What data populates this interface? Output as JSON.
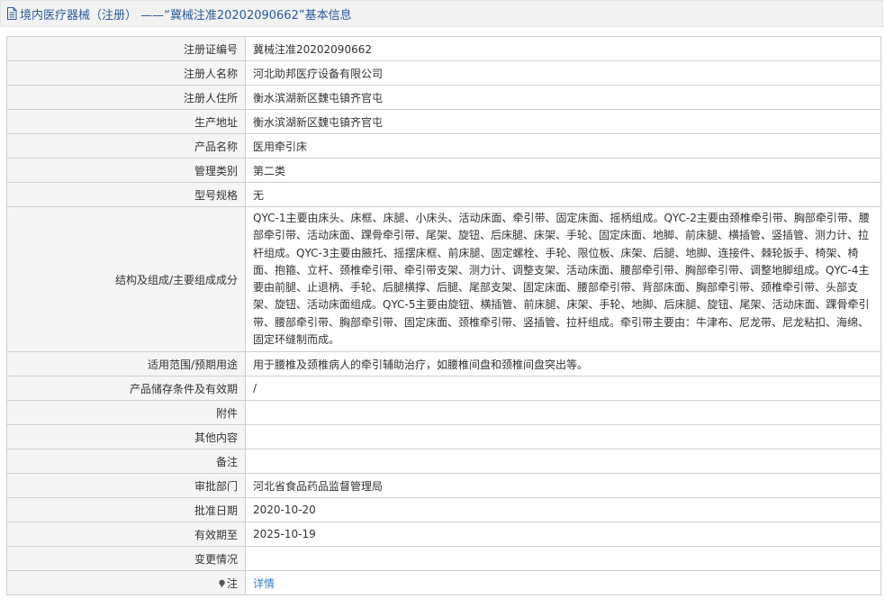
{
  "header": {
    "title": "境内医疗器械（注册） ——“冀械注准20202090662”基本信息",
    "icon": "document-icon"
  },
  "rows": [
    {
      "label": "注册证编号",
      "value": "冀械注准20202090662"
    },
    {
      "label": "注册人名称",
      "value": "河北助邦医疗设备有限公司"
    },
    {
      "label": "注册人住所",
      "value": "衡水滨湖新区魏屯镇齐官屯"
    },
    {
      "label": "生产地址",
      "value": "衡水滨湖新区魏屯镇齐官屯"
    },
    {
      "label": "产品名称",
      "value": "医用牵引床"
    },
    {
      "label": "管理类别",
      "value": "第二类"
    },
    {
      "label": "型号规格",
      "value": "无"
    },
    {
      "label": "结构及组成/主要组成成分",
      "value": "QYC-1主要由床头、床框、床腿、小床头、活动床面、牵引带、固定床面、摇柄组成。QYC-2主要由颈椎牵引带、胸部牵引带、腰部牵引带、活动床面、踝骨牵引带、尾架、旋钮、后床腿、床架、手轮、固定床面、地脚、前床腿、横插管、竖插管、测力计、拉杆组成。QYC-3主要由腋托、摇摆床框、前床腿、固定螺栓、手轮、限位板、床架、后腿、地脚、连接件、棘轮扳手、椅架、椅面、抱箍、立杆、颈椎牵引带、牵引带支架、测力计、调整支架、活动床面、腰部牵引带、胸部牵引带、调整地脚组成。QYC-4主要由前腿、止退柄、手轮、后腿横撑、后腿、尾部支架、固定床面、腰部牵引带、背部床面、胸部牵引带、颈椎牵引带、头部支架、旋钮、活动床面组成。QYC-5主要由旋钮、横插管、前床腿、床架、手轮、地脚、后床腿、旋钮、尾架、活动床面、踝骨牵引带、腰部牵引带、胸部牵引带、固定床面、颈椎牵引带、竖插管、拉杆组成。牵引带主要由：牛津布、尼龙带、尼龙粘扣、海绵、固定环缝制而成。"
    },
    {
      "label": "适用范围/预期用途",
      "value": "用于腰椎及颈椎病人的牵引辅助治疗，如腰椎间盘和颈椎间盘突出等。"
    },
    {
      "label": "产品储存条件及有效期",
      "value": "/"
    },
    {
      "label": "附件",
      "value": ""
    },
    {
      "label": "其他内容",
      "value": ""
    },
    {
      "label": "备注",
      "value": ""
    },
    {
      "label": "审批部门",
      "value": "河北省食品药品监督管理局"
    },
    {
      "label": "批准日期",
      "value": "2020-10-20"
    },
    {
      "label": "有效期至",
      "value": "2025-10-19"
    },
    {
      "label": "变更情况",
      "value": ""
    },
    {
      "label": "注",
      "value": "详情",
      "icon": "pin-icon"
    }
  ],
  "colors": {
    "header_bg": "#f2f2f2",
    "title": "#2d5a98",
    "link": "#3b7cc9",
    "label_bg": "#f5f5f5",
    "border": "#cfcfcf"
  }
}
